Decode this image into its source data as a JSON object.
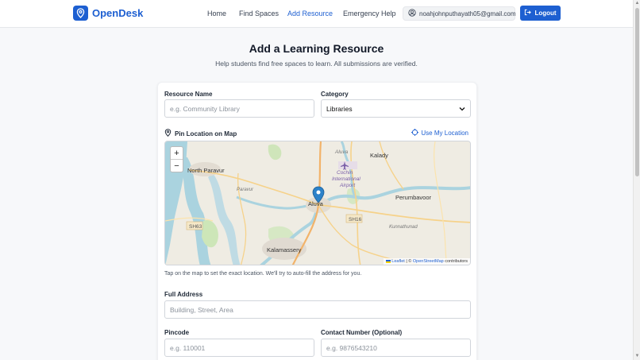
{
  "app": {
    "name": "OpenDesk"
  },
  "nav": {
    "links": [
      "Home",
      "Find Spaces",
      "Add Resource",
      "Emergency Help"
    ],
    "user_email": "noahjohnputhayath05@gmail.com",
    "logout_label": "Logout"
  },
  "page": {
    "title": "Add a Learning Resource",
    "subtitle": "Help students find free spaces to learn. All submissions are verified."
  },
  "form": {
    "resource_name": {
      "label": "Resource Name",
      "placeholder": "e.g. Community Library"
    },
    "category": {
      "label": "Category",
      "selected": "Libraries"
    },
    "pin_location": {
      "label": "Pin Location on Map",
      "use_my_location": "Use My Location"
    },
    "map": {
      "place_labels": [
        "North Paravur",
        "Aluva",
        "Kalady",
        "Cochin International Airport",
        "Perumbavoor",
        "SH16",
        "SH63",
        "Kalamassery",
        "Kunnathunad",
        "Paravur"
      ],
      "attribution": {
        "leaflet": "Leaflet",
        "separator": "| ©",
        "osm": "OpenStreetMap",
        "suffix": "contributors"
      },
      "zoom_in": "+",
      "zoom_out": "−"
    },
    "map_hint": "Tap on the map to set the exact location. We'll try to auto-fill the address for you.",
    "full_address": {
      "label": "Full Address",
      "placeholder": "Building, Street, Area"
    },
    "pincode": {
      "label": "Pincode",
      "placeholder": "e.g. 110001"
    },
    "contact": {
      "label": "Contact Number (Optional)",
      "placeholder": "e.g. 9876543210"
    }
  },
  "colors": {
    "accent": "#1d5fd1",
    "background": "#f7f8fa"
  }
}
